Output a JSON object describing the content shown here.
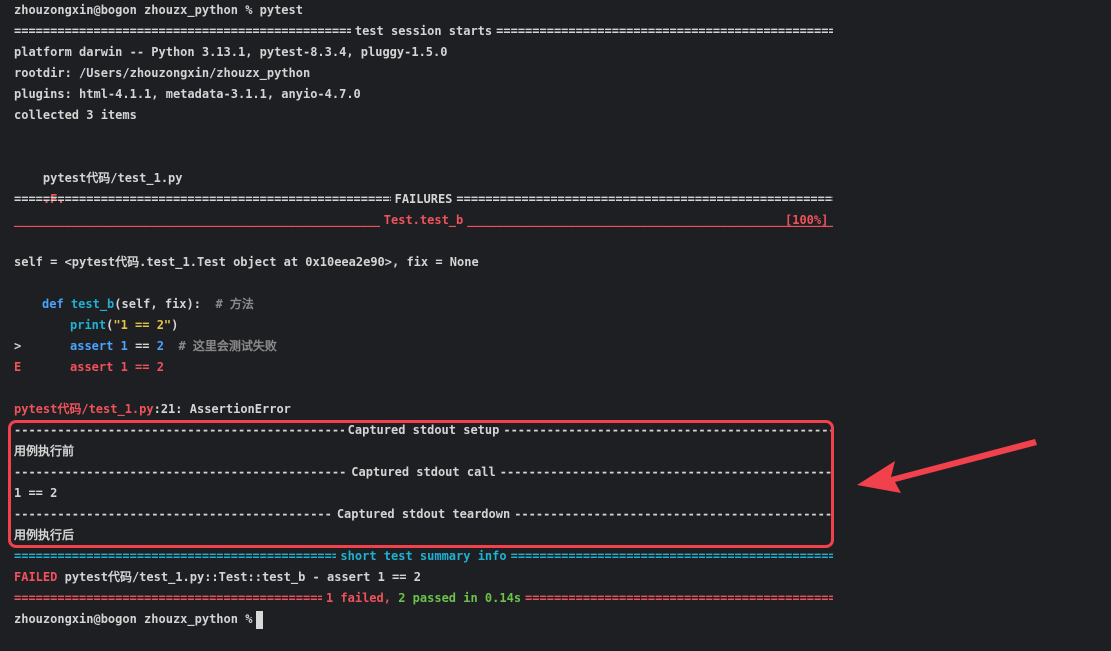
{
  "prompt_line": "zhouzongxin@bogon zhouzx_python % pytest",
  "session_title": "test session starts",
  "platform_line": "platform darwin -- Python 3.13.1, pytest-8.3.4, pluggy-1.5.0",
  "rootdir_line": "rootdir: /Users/zhouzongxin/zhouzx_python",
  "plugins_line": "plugins: html-4.1.1, metadata-3.1.1, anyio-4.7.0",
  "collected_line": "collected 3 items",
  "test_file": "pytest代码/test_1.py",
  "test_progress": ".F.",
  "test_percent": "[100%]",
  "failures_title": "FAILURES",
  "failure_test_name": "Test.test_b",
  "self_line": "self = <pytest代码.test_1.Test object at 0x10eea2e90>, fix = None",
  "code": {
    "def_kw": "def",
    "func_name": "test_b",
    "params": "(self, fix):",
    "comment1": "# 方法",
    "print_kw": "print",
    "print_open": "(",
    "print_str": "\"1 == 2\"",
    "print_close": ")",
    "marker_arrow": ">",
    "assert_kw": "assert",
    "num1": "1",
    "eq": "==",
    "num2": "2",
    "comment2": "# 这里会测试失败",
    "marker_e": "E",
    "error_assert": "assert 1 == 2"
  },
  "error_location": "pytest代码/test_1.py",
  "error_line_no": ":21:",
  "error_type": "AssertionError",
  "captured": [
    {
      "title": "Captured stdout setup",
      "output": "用例执行前"
    },
    {
      "title": "Captured stdout call",
      "output": "1 == 2"
    },
    {
      "title": "Captured stdout teardown",
      "output": "用例执行后"
    }
  ],
  "summary_title": "short test summary info",
  "failed_label": "FAILED",
  "failed_detail": "pytest代码/test_1.py::Test::test_b - assert 1 == 2",
  "result": {
    "failed": "1 failed",
    "sep": ",",
    "passed": "2 passed",
    "time": "in 0.14s"
  },
  "final_prompt": "zhouzongxin@bogon zhouzx_python %",
  "colors": {
    "background": "#1e1f22",
    "error_red": "#f0525c",
    "pass_green": "#6cc24a",
    "summary_cyan": "#1fb0d2",
    "annotation_red": "#f1414d"
  },
  "icons": {
    "annotation": "arrow-left-icon"
  }
}
